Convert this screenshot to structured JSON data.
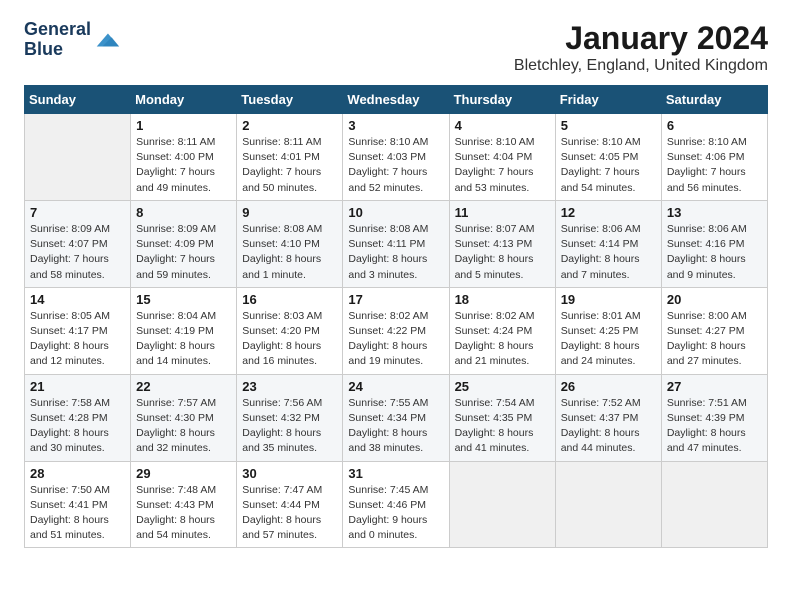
{
  "header": {
    "logo_line1": "General",
    "logo_line2": "Blue",
    "title": "January 2024",
    "subtitle": "Bletchley, England, United Kingdom"
  },
  "days_of_week": [
    "Sunday",
    "Monday",
    "Tuesday",
    "Wednesday",
    "Thursday",
    "Friday",
    "Saturday"
  ],
  "weeks": [
    [
      {
        "num": "",
        "info": ""
      },
      {
        "num": "1",
        "info": "Sunrise: 8:11 AM\nSunset: 4:00 PM\nDaylight: 7 hours\nand 49 minutes."
      },
      {
        "num": "2",
        "info": "Sunrise: 8:11 AM\nSunset: 4:01 PM\nDaylight: 7 hours\nand 50 minutes."
      },
      {
        "num": "3",
        "info": "Sunrise: 8:10 AM\nSunset: 4:03 PM\nDaylight: 7 hours\nand 52 minutes."
      },
      {
        "num": "4",
        "info": "Sunrise: 8:10 AM\nSunset: 4:04 PM\nDaylight: 7 hours\nand 53 minutes."
      },
      {
        "num": "5",
        "info": "Sunrise: 8:10 AM\nSunset: 4:05 PM\nDaylight: 7 hours\nand 54 minutes."
      },
      {
        "num": "6",
        "info": "Sunrise: 8:10 AM\nSunset: 4:06 PM\nDaylight: 7 hours\nand 56 minutes."
      }
    ],
    [
      {
        "num": "7",
        "info": "Sunrise: 8:09 AM\nSunset: 4:07 PM\nDaylight: 7 hours\nand 58 minutes."
      },
      {
        "num": "8",
        "info": "Sunrise: 8:09 AM\nSunset: 4:09 PM\nDaylight: 7 hours\nand 59 minutes."
      },
      {
        "num": "9",
        "info": "Sunrise: 8:08 AM\nSunset: 4:10 PM\nDaylight: 8 hours\nand 1 minute."
      },
      {
        "num": "10",
        "info": "Sunrise: 8:08 AM\nSunset: 4:11 PM\nDaylight: 8 hours\nand 3 minutes."
      },
      {
        "num": "11",
        "info": "Sunrise: 8:07 AM\nSunset: 4:13 PM\nDaylight: 8 hours\nand 5 minutes."
      },
      {
        "num": "12",
        "info": "Sunrise: 8:06 AM\nSunset: 4:14 PM\nDaylight: 8 hours\nand 7 minutes."
      },
      {
        "num": "13",
        "info": "Sunrise: 8:06 AM\nSunset: 4:16 PM\nDaylight: 8 hours\nand 9 minutes."
      }
    ],
    [
      {
        "num": "14",
        "info": "Sunrise: 8:05 AM\nSunset: 4:17 PM\nDaylight: 8 hours\nand 12 minutes."
      },
      {
        "num": "15",
        "info": "Sunrise: 8:04 AM\nSunset: 4:19 PM\nDaylight: 8 hours\nand 14 minutes."
      },
      {
        "num": "16",
        "info": "Sunrise: 8:03 AM\nSunset: 4:20 PM\nDaylight: 8 hours\nand 16 minutes."
      },
      {
        "num": "17",
        "info": "Sunrise: 8:02 AM\nSunset: 4:22 PM\nDaylight: 8 hours\nand 19 minutes."
      },
      {
        "num": "18",
        "info": "Sunrise: 8:02 AM\nSunset: 4:24 PM\nDaylight: 8 hours\nand 21 minutes."
      },
      {
        "num": "19",
        "info": "Sunrise: 8:01 AM\nSunset: 4:25 PM\nDaylight: 8 hours\nand 24 minutes."
      },
      {
        "num": "20",
        "info": "Sunrise: 8:00 AM\nSunset: 4:27 PM\nDaylight: 8 hours\nand 27 minutes."
      }
    ],
    [
      {
        "num": "21",
        "info": "Sunrise: 7:58 AM\nSunset: 4:28 PM\nDaylight: 8 hours\nand 30 minutes."
      },
      {
        "num": "22",
        "info": "Sunrise: 7:57 AM\nSunset: 4:30 PM\nDaylight: 8 hours\nand 32 minutes."
      },
      {
        "num": "23",
        "info": "Sunrise: 7:56 AM\nSunset: 4:32 PM\nDaylight: 8 hours\nand 35 minutes."
      },
      {
        "num": "24",
        "info": "Sunrise: 7:55 AM\nSunset: 4:34 PM\nDaylight: 8 hours\nand 38 minutes."
      },
      {
        "num": "25",
        "info": "Sunrise: 7:54 AM\nSunset: 4:35 PM\nDaylight: 8 hours\nand 41 minutes."
      },
      {
        "num": "26",
        "info": "Sunrise: 7:52 AM\nSunset: 4:37 PM\nDaylight: 8 hours\nand 44 minutes."
      },
      {
        "num": "27",
        "info": "Sunrise: 7:51 AM\nSunset: 4:39 PM\nDaylight: 8 hours\nand 47 minutes."
      }
    ],
    [
      {
        "num": "28",
        "info": "Sunrise: 7:50 AM\nSunset: 4:41 PM\nDaylight: 8 hours\nand 51 minutes."
      },
      {
        "num": "29",
        "info": "Sunrise: 7:48 AM\nSunset: 4:43 PM\nDaylight: 8 hours\nand 54 minutes."
      },
      {
        "num": "30",
        "info": "Sunrise: 7:47 AM\nSunset: 4:44 PM\nDaylight: 8 hours\nand 57 minutes."
      },
      {
        "num": "31",
        "info": "Sunrise: 7:45 AM\nSunset: 4:46 PM\nDaylight: 9 hours\nand 0 minutes."
      },
      {
        "num": "",
        "info": ""
      },
      {
        "num": "",
        "info": ""
      },
      {
        "num": "",
        "info": ""
      }
    ]
  ]
}
